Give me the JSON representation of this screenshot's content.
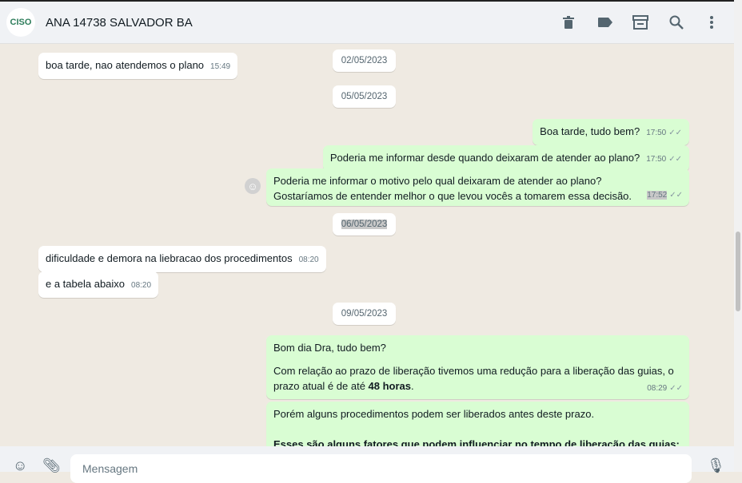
{
  "header": {
    "avatar_text": "CISO",
    "title": "ANA 14738 SALVADOR BA",
    "icons": [
      "trash-icon",
      "label-icon",
      "store-icon",
      "search-icon",
      "menu-icon"
    ]
  },
  "messages": [
    {
      "type": "in",
      "text": "boa tarde, nao atendemos o plano",
      "time": "15:49"
    },
    {
      "type": "date",
      "text": "02/05/2023"
    },
    {
      "type": "date",
      "text": "05/05/2023"
    },
    {
      "type": "out",
      "text": "Boa tarde, tudo bem?",
      "time": "17:50"
    },
    {
      "type": "out",
      "text": "Poderia me informar desde quando deixaram de atender ao plano?",
      "time": "17:50"
    },
    {
      "type": "out",
      "text": "Poderia me informar o motivo pelo qual deixaram de atender ao plano? Gostaríamos de entender melhor o que levou vocês a tomarem essa decisão.",
      "time": "17:52"
    },
    {
      "type": "date",
      "text": "06/05/2023"
    },
    {
      "type": "in",
      "text": "dificuldade e demora na liebracao dos procedimentos",
      "time": "08:20"
    },
    {
      "type": "in",
      "text": "e a tabela abaixo",
      "time": "08:20"
    },
    {
      "type": "date",
      "text": "09/05/2023"
    },
    {
      "type": "out",
      "line1": "Bom dia Dra, tudo bem?",
      "line2": "Com relação ao prazo de liberação tivemos uma redução para a liberação das guias, o prazo atual é de até ",
      "bold": "48 horas",
      "line2_end": ".",
      "time": "08:29"
    },
    {
      "type": "out",
      "line1": "Porém alguns procedimentos podem ser liberados antes deste prazo.",
      "bold": "Esses são alguns fatores que podem influenciar no tempo de liberação das guias:"
    }
  ],
  "footer": {
    "placeholder": "Mensagem"
  }
}
